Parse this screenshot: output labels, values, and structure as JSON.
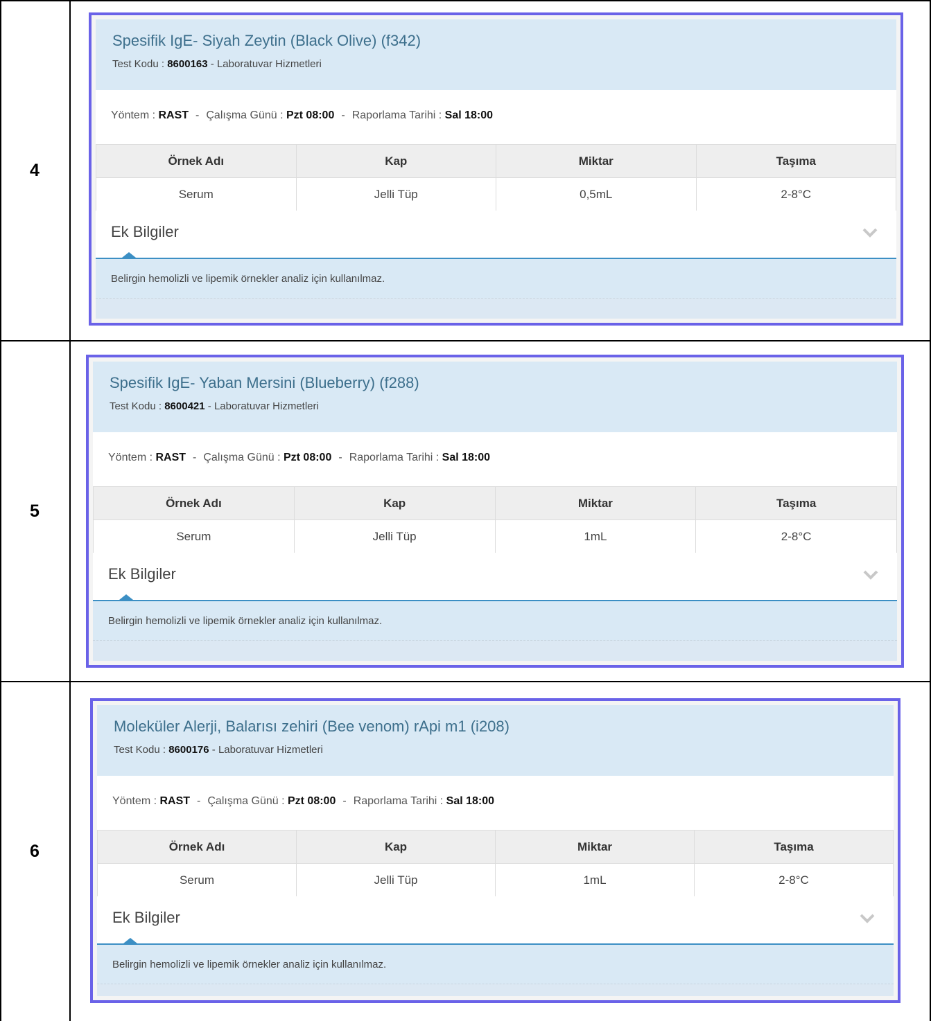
{
  "rows": [
    {
      "number": "4",
      "title": "Spesifik IgE- Siyah Zeytin (Black Olive) (f342)",
      "test_code_label": "Test Kodu : ",
      "test_code": "8600163",
      "lab_suffix": " - Laboratuvar Hizmetleri",
      "method_label": "Yöntem : ",
      "method": "RAST",
      "work_day_label": "Çalışma Günü : ",
      "work_day": "Pzt 08:00",
      "report_label": "Raporlama Tarihi : ",
      "report": "Sal 18:00",
      "table_headers": [
        "Örnek Adı",
        "Kap",
        "Miktar",
        "Taşıma"
      ],
      "table_values": [
        "Serum",
        "Jelli Tüp",
        "0,5mL",
        "2-8°C"
      ],
      "extra_label": "Ek Bilgiler",
      "note": "Belirgin hemolizli ve lipemik örnekler analiz için kullanılmaz."
    },
    {
      "number": "5",
      "title": "Spesifik IgE- Yaban Mersini (Blueberry) (f288)",
      "test_code_label": "Test Kodu : ",
      "test_code": "8600421",
      "lab_suffix": " - Laboratuvar Hizmetleri",
      "method_label": "Yöntem : ",
      "method": "RAST",
      "work_day_label": "Çalışma Günü : ",
      "work_day": "Pzt 08:00",
      "report_label": "Raporlama Tarihi : ",
      "report": "Sal 18:00",
      "table_headers": [
        "Örnek Adı",
        "Kap",
        "Miktar",
        "Taşıma"
      ],
      "table_values": [
        "Serum",
        "Jelli Tüp",
        "1mL",
        "2-8°C"
      ],
      "extra_label": "Ek Bilgiler",
      "note": "Belirgin hemolizli ve lipemik örnekler analiz için kullanılmaz."
    },
    {
      "number": "6",
      "title": "Moleküler Alerji, Balarısı zehiri (Bee venom) rApi m1 (i208)",
      "test_code_label": "Test Kodu : ",
      "test_code": "8600176",
      "lab_suffix": " - Laboratuvar Hizmetleri",
      "method_label": "Yöntem : ",
      "method": "RAST",
      "work_day_label": "Çalışma Günü : ",
      "work_day": "Pzt 08:00",
      "report_label": "Raporlama Tarihi : ",
      "report": "Sal 18:00",
      "table_headers": [
        "Örnek Adı",
        "Kap",
        "Miktar",
        "Taşıma"
      ],
      "table_values": [
        "Serum",
        "Jelli Tüp",
        "1mL",
        "2-8°C"
      ],
      "extra_label": "Ek Bilgiler",
      "note": "Belirgin hemolizli ve lipemik örnekler analiz için kullanılmaz."
    }
  ],
  "icons": {
    "expand": "chevron-down-icon"
  },
  "colors": {
    "card_border": "#6a62e8",
    "header_bg": "#d9e9f5",
    "title": "#3d6f8c",
    "accent_line": "#3c8fc4"
  }
}
